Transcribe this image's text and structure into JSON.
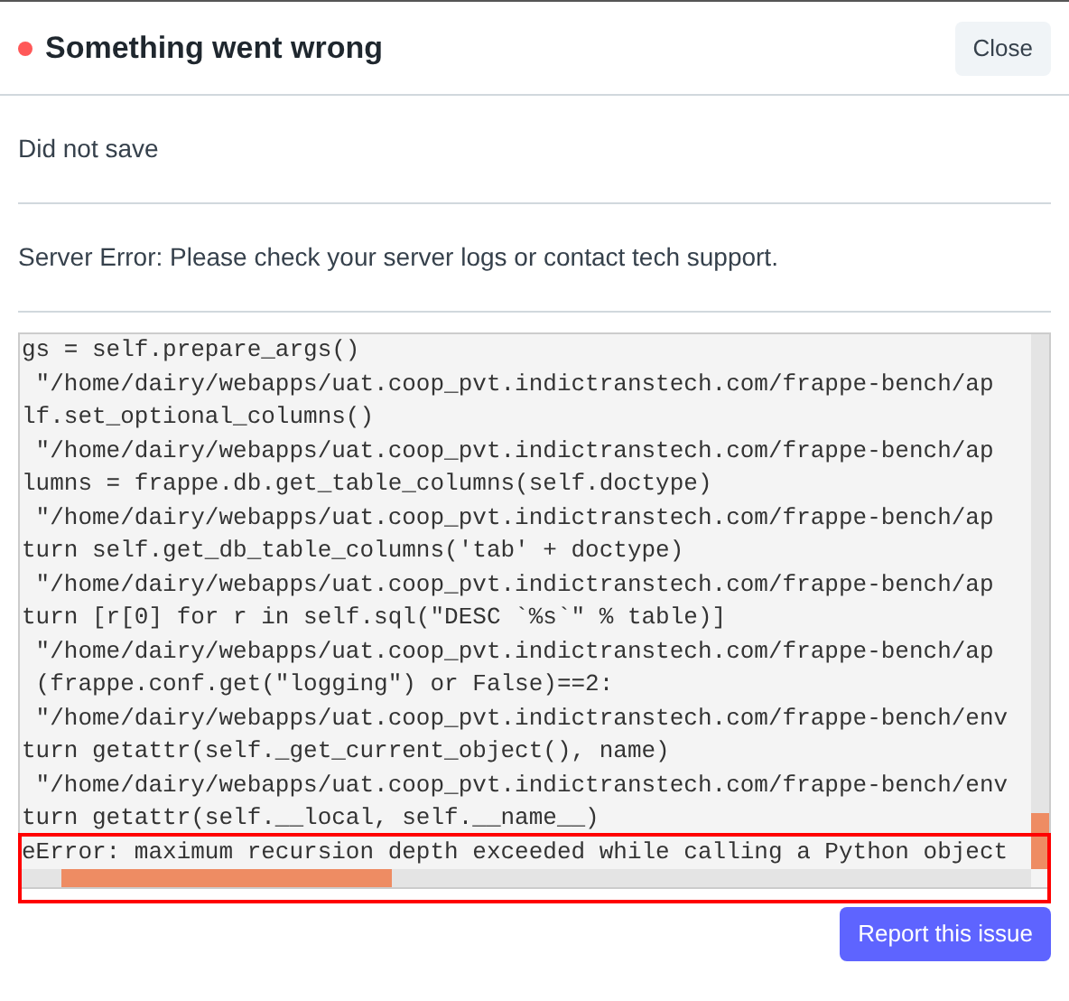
{
  "dialog": {
    "title": "Something went wrong",
    "close_button": "Close"
  },
  "messages": [
    "Did not save",
    "Server Error: Please check your server logs or contact tech support."
  ],
  "traceback": [
    "gs = self.prepare_args()",
    " \"/home/dairy/webapps/uat.coop_pvt.indictranstech.com/frappe-bench/ap",
    "lf.set_optional_columns()",
    " \"/home/dairy/webapps/uat.coop_pvt.indictranstech.com/frappe-bench/ap",
    "lumns = frappe.db.get_table_columns(self.doctype)",
    " \"/home/dairy/webapps/uat.coop_pvt.indictranstech.com/frappe-bench/ap",
    "turn self.get_db_table_columns('tab' + doctype)",
    " \"/home/dairy/webapps/uat.coop_pvt.indictranstech.com/frappe-bench/ap",
    "turn [r[0] for r in self.sql(\"DESC `%s`\" % table)]",
    " \"/home/dairy/webapps/uat.coop_pvt.indictranstech.com/frappe-bench/ap",
    " (frappe.conf.get(\"logging\") or False)==2:",
    " \"/home/dairy/webapps/uat.coop_pvt.indictranstech.com/frappe-bench/env",
    "turn getattr(self._get_current_object(), name)",
    " \"/home/dairy/webapps/uat.coop_pvt.indictranstech.com/frappe-bench/env",
    "turn getattr(self.__local, self.__name__)",
    "eError: maximum recursion depth exceeded while calling a Python object"
  ],
  "report_button": "Report this issue"
}
